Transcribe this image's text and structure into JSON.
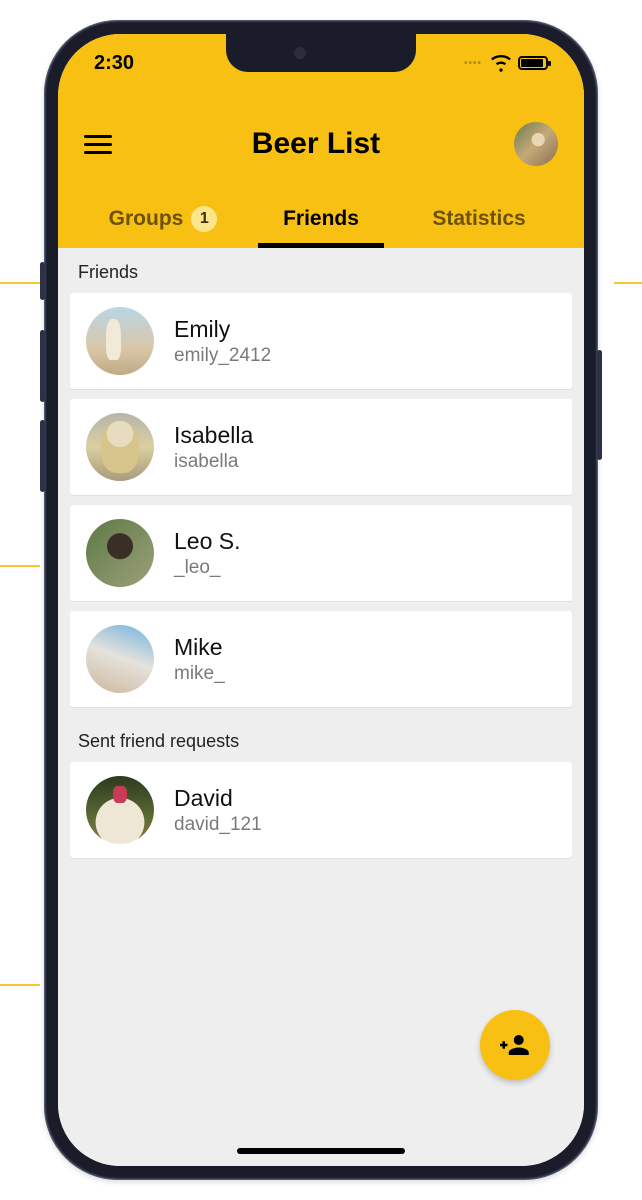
{
  "status": {
    "time": "2:30"
  },
  "header": {
    "title": "Beer List"
  },
  "tabs": {
    "groups": {
      "label": "Groups",
      "badge": "1"
    },
    "friends": {
      "label": "Friends"
    },
    "stats": {
      "label": "Statistics"
    }
  },
  "sections": {
    "friends_label": "Friends",
    "sent_label": "Sent friend requests"
  },
  "friends": [
    {
      "name": "Emily",
      "user": "emily_2412"
    },
    {
      "name": "Isabella",
      "user": "isabella"
    },
    {
      "name": "Leo S.",
      "user": "_leo_"
    },
    {
      "name": "Mike",
      "user": "mike_"
    }
  ],
  "sent": [
    {
      "name": "David",
      "user": "david_121"
    }
  ],
  "icons": {
    "menu": "menu-icon",
    "wifi": "wifi-icon",
    "battery": "battery-icon",
    "add_friend": "person-add-icon"
  },
  "colors": {
    "accent": "#f7c012"
  }
}
